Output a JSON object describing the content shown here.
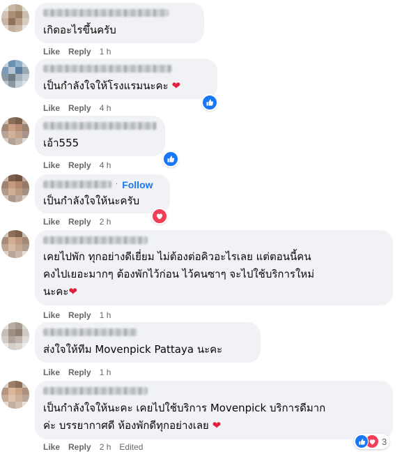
{
  "action_labels": {
    "like": "Like",
    "reply": "Reply",
    "edited": "Edited"
  },
  "comments": [
    {
      "text": "เกิดอะไรขึ้นครับ",
      "time": "1 h",
      "reaction": ""
    },
    {
      "text": "เป็นกำลังใจให้โรงแรมนะคะ",
      "heart": "❤",
      "time": "4 h",
      "reaction": "like"
    },
    {
      "text": "เอ้า555",
      "time": "4 h",
      "reaction": "like"
    },
    {
      "text": "เป็นกำลังใจให้นะครับ",
      "follow": "Follow",
      "time": "2 h",
      "reaction": "love"
    },
    {
      "lines": [
        "เคยไปพัก ทุกอย่างดีเยี่ยม ไม่ต้องต่อคิวอะไรเลย แต่ตอนนี้คน",
        "คงไปเยอะมากๆ ต้องพักไว้ก่อน ไว้คนซาๆ จะไปใช้บริการใหม่",
        "นะคะ"
      ],
      "heart": "❤",
      "time": "1 h",
      "reaction": ""
    },
    {
      "text": "ส่งใจให้ทีม Movenpick Pattaya นะคะ",
      "time": "1 h",
      "reaction": ""
    },
    {
      "lines": [
        "เป็นกำลังใจให้นะคะ เคยไปใช้บริการ Movenpick บริการดีมาก",
        "ค่ะ บรรยากาศดี ห้องพักดีทุกอย่างเลย"
      ],
      "heart": "❤",
      "time": "2 h",
      "edited": true,
      "reaction_count": "3"
    }
  ],
  "colors": {
    "bubble": "#f0f2f5",
    "text": "#050505",
    "meta": "#65676b",
    "link": "#1877f2",
    "like": "#1877f2",
    "love": "#f33e58",
    "heart": "#e41e3f"
  },
  "icons": {
    "like": "thumbs-up-icon",
    "love": "heart-icon"
  }
}
